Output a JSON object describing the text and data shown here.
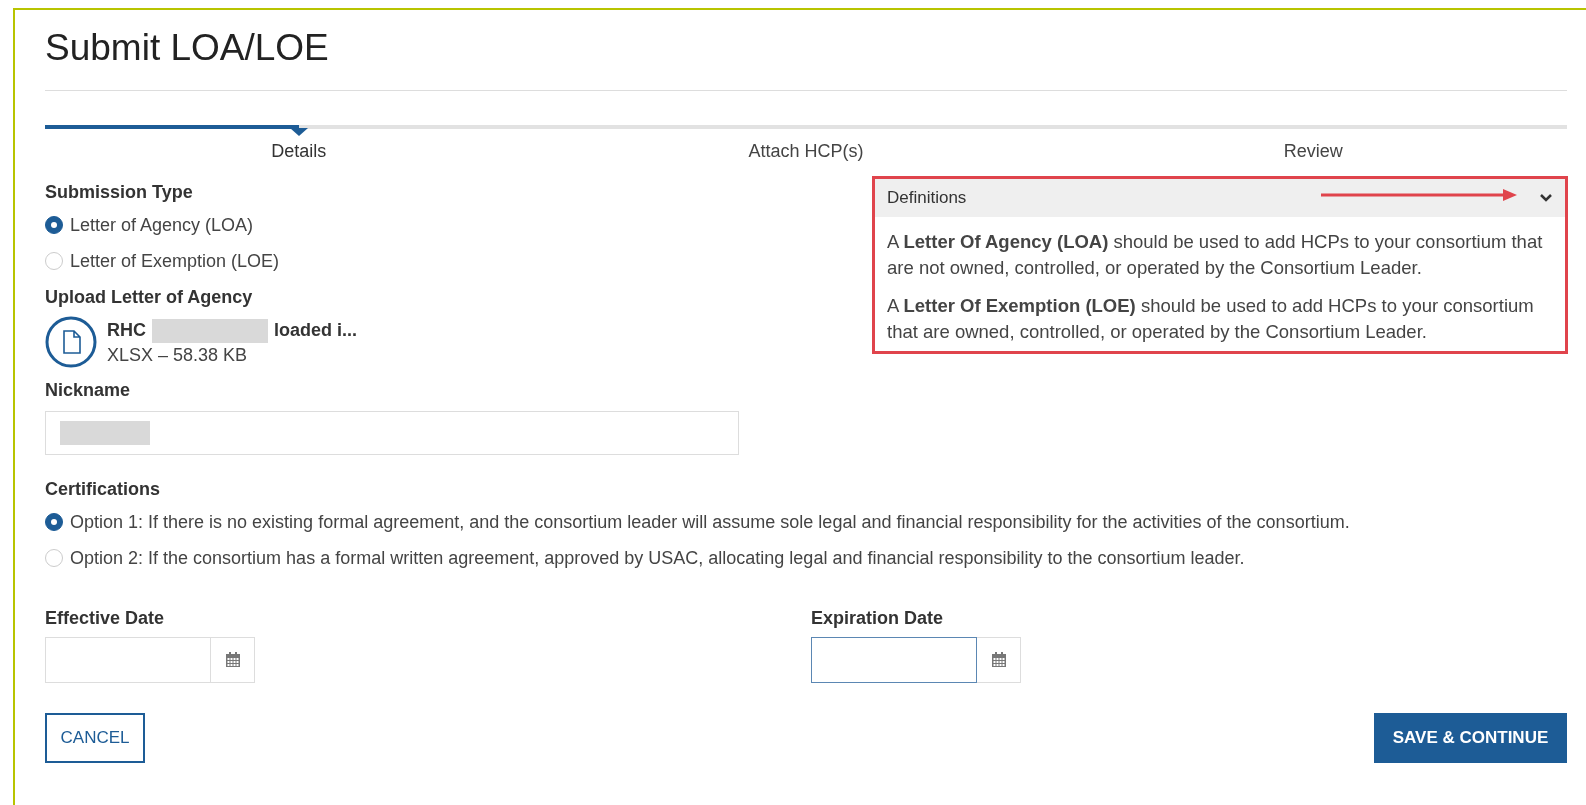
{
  "title": "Submit LOA/LOE",
  "steps": [
    {
      "label": "Details",
      "selected": true
    },
    {
      "label": "Attach HCP(s)",
      "selected": false
    },
    {
      "label": "Review",
      "selected": false
    }
  ],
  "submission_type": {
    "label": "Submission Type",
    "options": [
      {
        "label": "Letter of Agency (LOA)",
        "selected": true
      },
      {
        "label": "Letter of Exemption (LOE)",
        "selected": false
      }
    ]
  },
  "upload": {
    "label": "Upload Letter of Agency",
    "file_name_start": "RHC",
    "file_name_end": "loaded i...",
    "file_info": "XLSX – 58.38 KB"
  },
  "nickname": {
    "label": "Nickname"
  },
  "definitions": {
    "title": "Definitions",
    "expanded": true,
    "paragraphs": [
      "A **Letter Of Agency (LOA)** should be used to add HCPs to your consortium that are not owned, controlled, or operated by the Consortium Leader.",
      "A **Letter Of Exemption (LOE)** should be used to add HCPs to your consortium that are owned, controlled, or operated by the Consortium Leader."
    ]
  },
  "certifications": {
    "label": "Certifications",
    "options": [
      {
        "label": "Option 1: If there is no existing formal agreement, and the consortium leader will assume sole legal and financial responsibility for the activities of the consortium.",
        "selected": true
      },
      {
        "label": "Option 2: If the consortium has a formal written agreement, approved by USAC, allocating legal and financial responsibility to the consortium leader.",
        "selected": false
      }
    ]
  },
  "dates": [
    {
      "label": "Effective Date",
      "focused": false
    },
    {
      "label": "Expiration Date",
      "focused": true
    }
  ],
  "buttons": {
    "cancel": "CANCEL",
    "save": "SAVE & CONTINUE"
  }
}
